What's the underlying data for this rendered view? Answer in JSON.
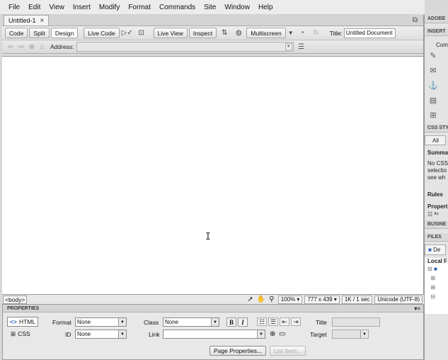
{
  "menubar": [
    "File",
    "Edit",
    "View",
    "Insert",
    "Modify",
    "Format",
    "Commands",
    "Site",
    "Window",
    "Help"
  ],
  "document": {
    "tab_label": "Untitled-1",
    "toolbar": {
      "code": "Code",
      "split": "Split",
      "design": "Design",
      "live_code": "Live Code",
      "live_view": "Live View",
      "inspect": "Inspect",
      "multiscreen": "Multiscreen",
      "title_label": "Title:",
      "title_value": "Untitled Document"
    },
    "address_label": "Address:"
  },
  "statusbar": {
    "tag": "<body>",
    "zoom": "100%",
    "window_size": "777 x 439",
    "download": "1K / 1 sec",
    "encoding": "Unicode (UTF-8)"
  },
  "properties": {
    "header": "PROPERTIES",
    "html_mode": "HTML",
    "css_mode": "CSS",
    "format_label": "Format",
    "format_value": "None",
    "id_label": "ID",
    "id_value": "None",
    "class_label": "Class",
    "class_value": "None",
    "link_label": "Link",
    "title_label": "Title",
    "target_label": "Target",
    "bold": "B",
    "italic": "I",
    "page_properties": "Page Properties...",
    "list_item": "List Item..."
  },
  "right_panel": {
    "adobe_header": "ADOBE",
    "insert_header": "INSERT",
    "insert_sub": "Com",
    "css_header": "CSS STY",
    "css_all": "All",
    "summary": "Summar",
    "summary_text": [
      "No CSS",
      "selectio",
      "see wh"
    ],
    "rules": "Rules",
    "properties": "Propert",
    "business_header": "BUSINE",
    "files_header": "FILES",
    "files_site": "De",
    "local": "Local F"
  }
}
